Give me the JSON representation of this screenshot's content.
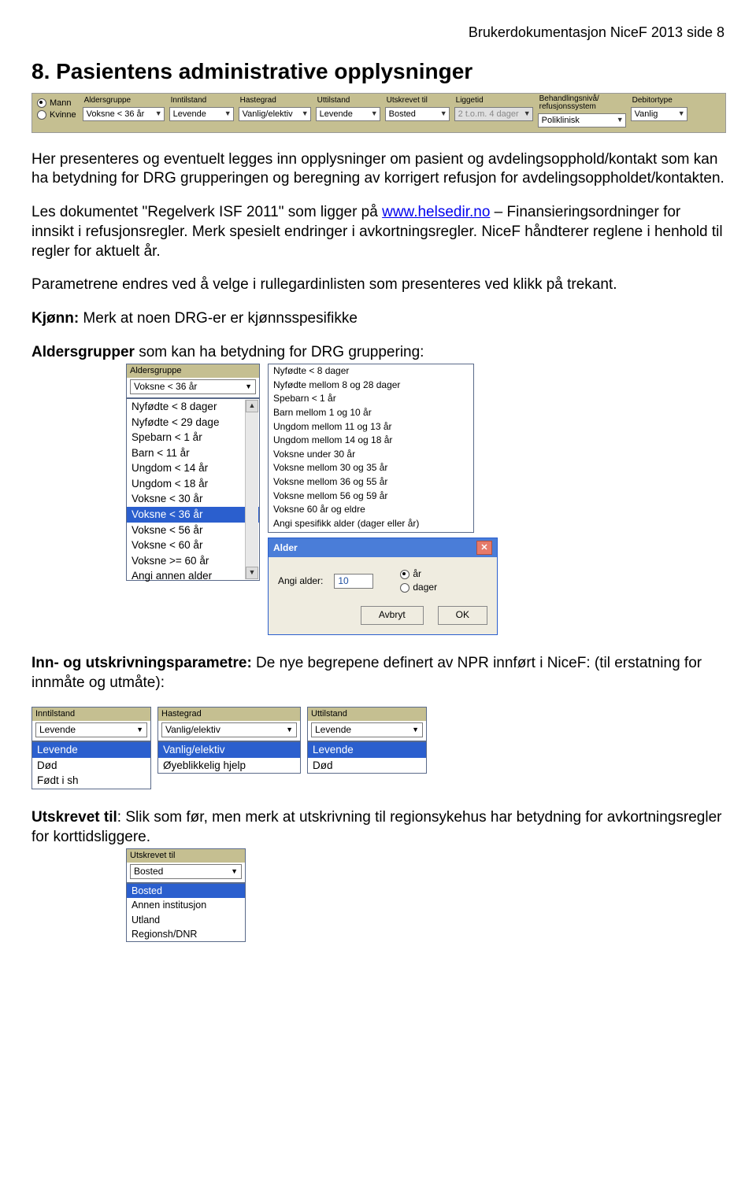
{
  "page_header": "Brukerdokumentasjon NiceF 2013 side 8",
  "h1": "8. Pasientens administrative opplysninger",
  "toolbar": {
    "gender": {
      "mann": "Mann",
      "kvinne": "Kvinne"
    },
    "cols": [
      {
        "label": "Aldersgruppe",
        "value": "Voksne < 36 år"
      },
      {
        "label": "Inntilstand",
        "value": "Levende"
      },
      {
        "label": "Hastegrad",
        "value": "Vanlig/elektiv"
      },
      {
        "label": "Uttilstand",
        "value": "Levende"
      },
      {
        "label": "Utskrevet til",
        "value": "Bosted"
      },
      {
        "label": "Liggetid",
        "value": "2 t.o.m. 4 dager",
        "disabled": true
      },
      {
        "label": "Behandlingsnivå/ refusjonssystem",
        "value": "Poliklinisk"
      },
      {
        "label": "Debitortype",
        "value": "Vanlig"
      }
    ]
  },
  "para1": "Her presenteres og eventuelt legges inn opplysninger om pasient og avdelingsopphold/kontakt som kan ha betydning for DRG grupperingen og beregning av korrigert refusjon for avdelingsoppholdet/kontakten.",
  "para2_a": "Les dokumentet \"Regelverk ISF 2011\" som ligger på ",
  "para2_link": "www.helsedir.no",
  "para2_b": " – Finansieringsordninger for innsikt i refusjonsregler. Merk spesielt endringer i avkortningsregler. NiceF håndterer reglene i henhold til regler for aktuelt år.",
  "para3": "Parametrene endres ved å velge i rullegardinlisten som presenteres ved klikk på trekant.",
  "kjonn_label": "Kjønn:",
  "kjonn_text": "  Merk at noen DRG-er er kjønnsspesifikke",
  "alders_label": "Aldersgrupper",
  "alders_text": " som kan ha betydning for DRG gruppering:",
  "age_box_title": "Aldersgruppe",
  "age_box_value": "Voksne < 36 år",
  "age_list_left": [
    "Nyfødte < 8 dager",
    "Nyfødte < 29 dage",
    "Spebarn < 1 år",
    "Barn < 11 år",
    "Ungdom < 14 år",
    "Ungdom < 18 år",
    "Voksne < 30 år",
    "Voksne < 36 år",
    "Voksne < 56 år",
    "Voksne < 60 år",
    "Voksne >= 60 år",
    "Angi annen alder"
  ],
  "age_list_left_sel": 7,
  "age_list_right": [
    "Nyfødte           <   8 dager",
    "Nyfødte mellom 8 og 28 dager",
    "Spebarn           <   1 år",
    "Barn mellom 1 og 10 år",
    "Ungdom mellom 11 og 13 år",
    "Ungdom mellom 14 og 18 år",
    "Voksne under 30 år",
    "Voksne mellom 30 og 35 år",
    "Voksne mellom 36 og 55 år",
    "Voksne mellom 56 og 59 år",
    "Voksne 60 år og eldre",
    "Angi spesifikk alder (dager eller år)"
  ],
  "dialog": {
    "title": "Alder",
    "label": "Angi alder:",
    "value": "10",
    "opt_ar": "år",
    "opt_dager": "dager",
    "cancel": "Avbryt",
    "ok": "OK"
  },
  "inn_label": "Inn- og utskrivningsparametre:",
  "inn_text": "  De nye begrepene definert av NPR innført i NiceF: (til erstatning for innmåte og utmåte):",
  "three": [
    {
      "title": "Inntilstand",
      "value": "Levende",
      "opts": [
        "Levende",
        "Død",
        "Født i sh"
      ],
      "sel": 0
    },
    {
      "title": "Hastegrad",
      "value": "Vanlig/elektiv",
      "opts": [
        "Vanlig/elektiv",
        "Øyeblikkelig hjelp"
      ],
      "sel": 0
    },
    {
      "title": "Uttilstand",
      "value": "Levende",
      "opts": [
        "Levende",
        "Død"
      ],
      "sel": 0
    }
  ],
  "utskrevet_label": "Utskrevet til",
  "utskrevet_text": ":  Slik som før, men merk at utskrivning til regionsykehus har betydning for avkortningsregler for korttidsliggere.",
  "utskrevet_box": {
    "title": "Utskrevet til",
    "value": "Bosted",
    "opts": [
      "Bosted",
      "Annen institusjon",
      "Utland",
      "Regionsh/DNR"
    ],
    "sel": 0
  }
}
